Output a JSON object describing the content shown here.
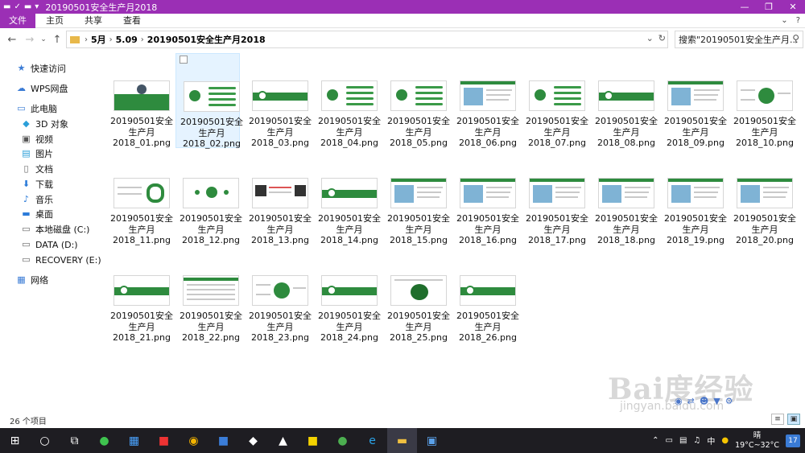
{
  "window": {
    "title": "20190501安全生产月2018",
    "controls": [
      "—",
      "❐",
      "✕"
    ]
  },
  "ribbon": {
    "tabs": [
      "文件",
      "主页",
      "共享",
      "查看"
    ],
    "right": [
      "⌄",
      "?"
    ]
  },
  "address": {
    "segments": [
      "5月",
      "5.09",
      "20190501安全生产月2018"
    ],
    "separator": "›"
  },
  "search": {
    "placeholder": "搜索\"20190501安全生产月..."
  },
  "sidebar": {
    "items": [
      {
        "label": "快速访问",
        "icon": "star-icon"
      },
      {
        "label": "WPS网盘",
        "icon": "cloud-icon"
      },
      {
        "label": "此电脑",
        "icon": "computer-icon"
      },
      {
        "label": "3D 对象",
        "icon": "cube-icon"
      },
      {
        "label": "视频",
        "icon": "video-icon"
      },
      {
        "label": "图片",
        "icon": "picture-icon"
      },
      {
        "label": "文档",
        "icon": "document-icon"
      },
      {
        "label": "下载",
        "icon": "download-icon"
      },
      {
        "label": "音乐",
        "icon": "music-icon"
      },
      {
        "label": "桌面",
        "icon": "desktop-icon"
      },
      {
        "label": "本地磁盘 (C:)",
        "icon": "drive-icon"
      },
      {
        "label": "DATA (D:)",
        "icon": "drive-icon"
      },
      {
        "label": "RECOVERY (E:)",
        "icon": "drive-icon"
      },
      {
        "label": "网络",
        "icon": "network-icon"
      }
    ]
  },
  "files": [
    {
      "line1": "20190501安全",
      "line2": "生产月",
      "line3": "2018_01.png"
    },
    {
      "line1": "20190501安全",
      "line2": "生产月",
      "line3": "2018_02.png"
    },
    {
      "line1": "20190501安全",
      "line2": "生产月",
      "line3": "2018_03.png"
    },
    {
      "line1": "20190501安全",
      "line2": "生产月",
      "line3": "2018_04.png"
    },
    {
      "line1": "20190501安全",
      "line2": "生产月",
      "line3": "2018_05.png"
    },
    {
      "line1": "20190501安全",
      "line2": "生产月",
      "line3": "2018_06.png"
    },
    {
      "line1": "20190501安全",
      "line2": "生产月",
      "line3": "2018_07.png"
    },
    {
      "line1": "20190501安全",
      "line2": "生产月",
      "line3": "2018_08.png"
    },
    {
      "line1": "20190501安全",
      "line2": "生产月",
      "line3": "2018_09.png"
    },
    {
      "line1": "20190501安全",
      "line2": "生产月",
      "line3": "2018_10.png"
    },
    {
      "line1": "20190501安全",
      "line2": "生产月",
      "line3": "2018_11.png"
    },
    {
      "line1": "20190501安全",
      "line2": "生产月",
      "line3": "2018_12.png"
    },
    {
      "line1": "20190501安全",
      "line2": "生产月",
      "line3": "2018_13.png"
    },
    {
      "line1": "20190501安全",
      "line2": "生产月",
      "line3": "2018_14.png"
    },
    {
      "line1": "20190501安全",
      "line2": "生产月",
      "line3": "2018_15.png"
    },
    {
      "line1": "20190501安全",
      "line2": "生产月",
      "line3": "2018_16.png"
    },
    {
      "line1": "20190501安全",
      "line2": "生产月",
      "line3": "2018_17.png"
    },
    {
      "line1": "20190501安全",
      "line2": "生产月",
      "line3": "2018_18.png"
    },
    {
      "line1": "20190501安全",
      "line2": "生产月",
      "line3": "2018_19.png"
    },
    {
      "line1": "20190501安全",
      "line2": "生产月",
      "line3": "2018_20.png"
    },
    {
      "line1": "20190501安全",
      "line2": "生产月",
      "line3": "2018_21.png"
    },
    {
      "line1": "20190501安全",
      "line2": "生产月",
      "line3": "2018_22.png"
    },
    {
      "line1": "20190501安全",
      "line2": "生产月",
      "line3": "2018_23.png"
    },
    {
      "line1": "20190501安全",
      "line2": "生产月",
      "line3": "2018_24.png"
    },
    {
      "line1": "20190501安全",
      "line2": "生产月",
      "line3": "2018_25.png"
    },
    {
      "line1": "20190501安全",
      "line2": "生产月",
      "line3": "2018_26.png"
    }
  ],
  "status": {
    "count": "26 个项目"
  },
  "taskbar": {
    "weather": "晴",
    "temp": "19°C~32°C",
    "ime": "中",
    "notifications": "17"
  },
  "watermark": {
    "brand": "Bai度经验",
    "url": "jingyan.baidu.com"
  },
  "colors": {
    "accent": "#9b2fb5",
    "thumb_green": "#2e8b3e",
    "taskbar": "#1e1d22"
  }
}
